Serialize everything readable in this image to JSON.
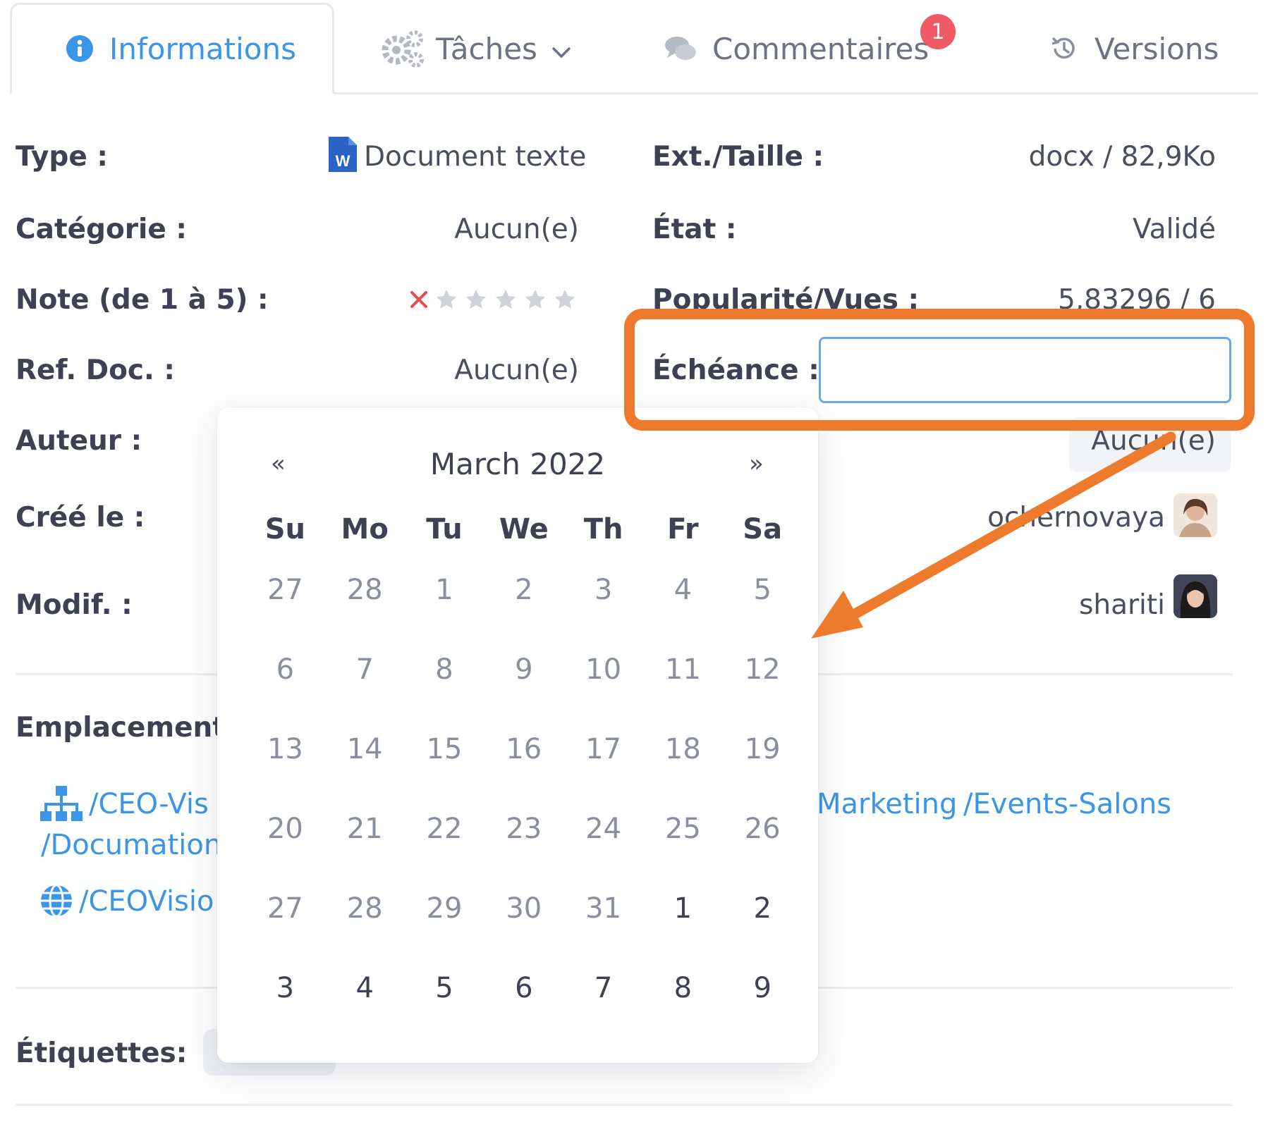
{
  "tabs": [
    {
      "label": "Informations",
      "icon": "info-circle-icon",
      "active": true
    },
    {
      "label": "Tâches",
      "icon": "gears-icon",
      "has_dropdown": true
    },
    {
      "label": "Commentaires",
      "icon": "comments-icon",
      "badge": "1"
    },
    {
      "label": "Versions",
      "icon": "history-icon"
    }
  ],
  "info": {
    "type_label": "Type :",
    "type_value": "Document texte",
    "type_icon": "word-document-icon",
    "ext_label": "Ext./Taille :",
    "ext_value": "docx / 82,9Ko",
    "categorie_label": "Catégorie :",
    "categorie_value": "Aucun(e)",
    "etat_label": "État :",
    "etat_value": "Validé",
    "note_label": "Note (de 1 à 5) :",
    "note_rating": 0,
    "note_max": 5,
    "popularite_label": "Popularité/Vues :",
    "popularite_value": "5,83296 / 6",
    "ref_label": "Ref. Doc. :",
    "ref_value": "Aucun(e)",
    "echeance_label": "Échéance :",
    "echeance_value": "",
    "auteur_label": "Auteur :",
    "auteur_right_value": "Aucun(e)",
    "cree_label": "Créé le :",
    "cree_user": "ochernovaya",
    "modif_label": "Modif. :",
    "modif_user": "shariti",
    "emplacements_label": "Emplacements",
    "emplacement_links": [
      "/CEO-Vis",
      "/Documation",
      "/CEOVisio",
      "Marketing",
      "/Events-Salons"
    ],
    "etiquettes_label": "Étiquettes:"
  },
  "datepicker": {
    "prev": "«",
    "next": "»",
    "month_year": "March 2022",
    "weekdays": [
      "Su",
      "Mo",
      "Tu",
      "We",
      "Th",
      "Fr",
      "Sa"
    ],
    "weeks": [
      [
        "27",
        "28",
        "1",
        "2",
        "3",
        "4",
        "5"
      ],
      [
        "6",
        "7",
        "8",
        "9",
        "10",
        "11",
        "12"
      ],
      [
        "13",
        "14",
        "15",
        "16",
        "17",
        "18",
        "19"
      ],
      [
        "20",
        "21",
        "22",
        "23",
        "24",
        "25",
        "26"
      ],
      [
        "27",
        "28",
        "29",
        "30",
        "31",
        "1",
        "2"
      ],
      [
        "3",
        "4",
        "5",
        "6",
        "7",
        "8",
        "9"
      ]
    ],
    "current_month_from": [
      4,
      5
    ]
  },
  "colors": {
    "accent": "#3b95e8",
    "highlight": "#ee7a2d",
    "badge": "#f05a66"
  }
}
